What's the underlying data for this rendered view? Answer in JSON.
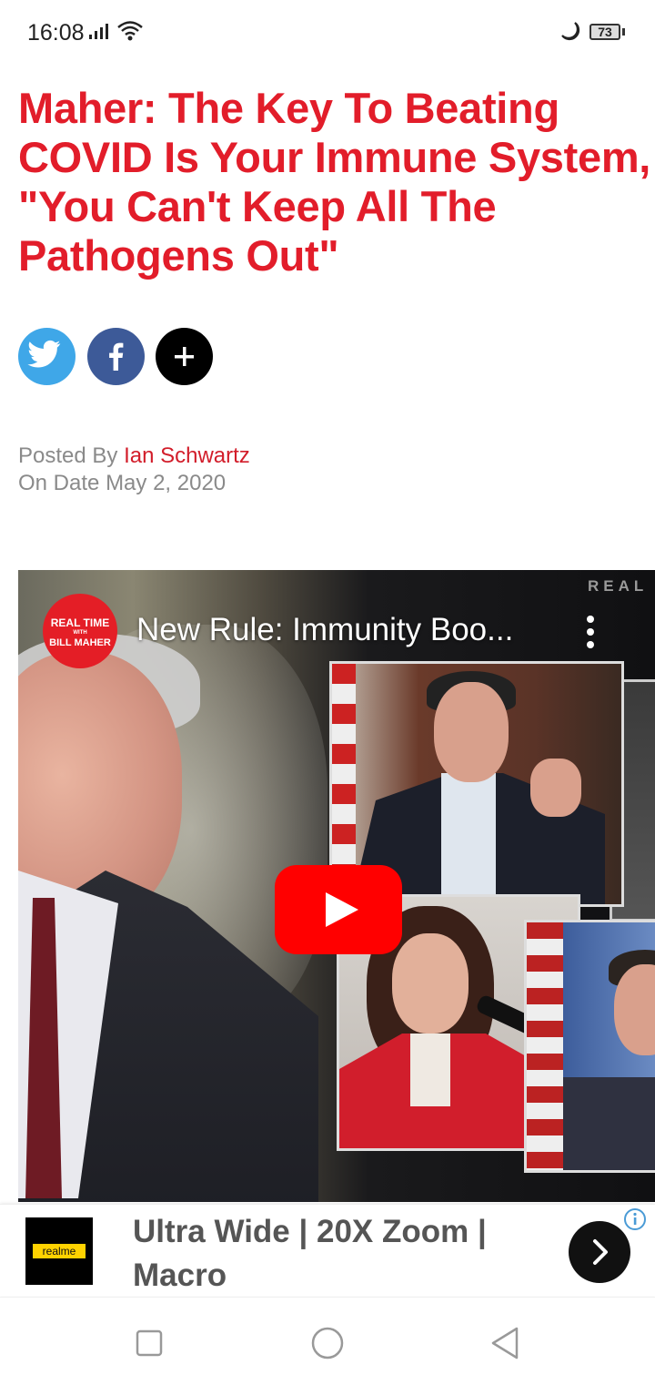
{
  "status_bar": {
    "time": "16:08",
    "battery": "73"
  },
  "article": {
    "headline": "Maher: The Key To Beating COVID Is Your Immune System, \"You Can't Keep All The Pathogens Out\"",
    "posted_by_label": "Posted By",
    "author": "Ian Schwartz",
    "date_label": "On Date",
    "date": "May 2, 2020"
  },
  "share": {
    "buttons": [
      {
        "icon": "twitter-icon",
        "color": "#3fa7e8"
      },
      {
        "icon": "facebook-icon",
        "color": "#3d5a98"
      },
      {
        "icon": "plus-icon",
        "color": "#000000"
      }
    ]
  },
  "video": {
    "channel_logo_lines": [
      "REAL TIME",
      "WITH",
      "BILL MAHER"
    ],
    "title": "New Rule: Immunity Boo...",
    "watermark": "REAL",
    "accent": "#ff0000"
  },
  "ad": {
    "brand": "realme",
    "text": "Ultra Wide | 20X Zoom | Macro"
  },
  "colors": {
    "headline": "#e21d2a",
    "author_link": "#d21d2a",
    "meta_text": "#8a8a8a"
  }
}
